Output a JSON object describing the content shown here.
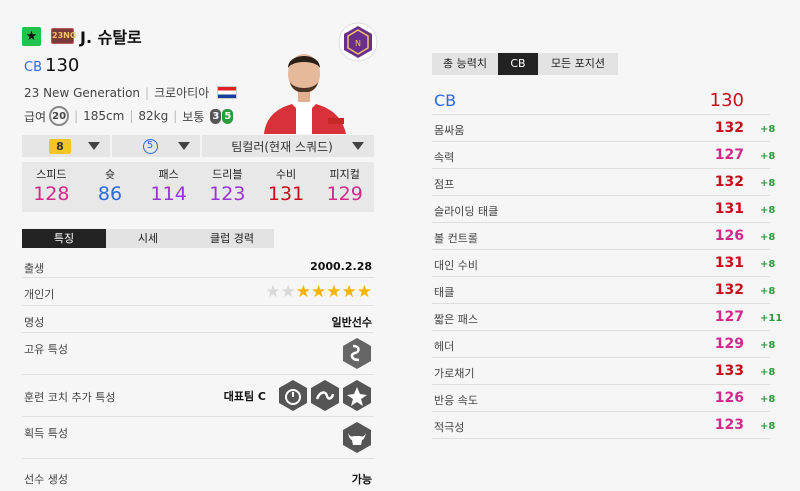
{
  "player": {
    "star_icon": "star-icon",
    "season_badge": "23NG",
    "name": "J. 슈탈로",
    "position": "CB",
    "overall": "130",
    "season_name": "23 New Generation",
    "nationality": "크로아티아",
    "salary_label": "급여",
    "salary": "20",
    "height": "185cm",
    "weight": "82kg",
    "body_type": "보통",
    "left_foot": "3",
    "right_foot": "5"
  },
  "controls": {
    "upgrade_level": "8",
    "enhance_level": "5",
    "team_color": "팀컬러(현재 스쿼드)"
  },
  "summary": [
    {
      "label": "스피드",
      "value": "128",
      "color": "#d02a8a"
    },
    {
      "label": "슛",
      "value": "86",
      "color": "#2b6ae0"
    },
    {
      "label": "패스",
      "value": "114",
      "color": "#9b34d6"
    },
    {
      "label": "드리블",
      "value": "123",
      "color": "#9b34d6"
    },
    {
      "label": "수비",
      "value": "131",
      "color": "#c4101c"
    },
    {
      "label": "피지컬",
      "value": "129",
      "color": "#d02a8a"
    }
  ],
  "tabs": [
    "특징",
    "시세",
    "클럽 경력"
  ],
  "details": {
    "birth_label": "출생",
    "birth": "2000.2.28",
    "popularity_label": "개인기",
    "popularity_stars": 5,
    "reputation_label": "명성",
    "reputation": "일반선수",
    "unique_trait_label": "고유 특성",
    "coach_trait_label": "훈련 코치 추가 특성",
    "national_team": "대표팀 C",
    "acquired_trait_label": "획득 특성",
    "creation_label": "선수 생성",
    "creation": "가능"
  },
  "right_tabs": [
    "총 능력치",
    "CB",
    "모든 포지션"
  ],
  "position_overall": {
    "label": "CB",
    "value": "130"
  },
  "stats": [
    {
      "name": "몸싸움",
      "value": "132",
      "delta": "+8",
      "color": "#c4101c"
    },
    {
      "name": "속력",
      "value": "127",
      "delta": "+8",
      "color": "#d02a8a"
    },
    {
      "name": "점프",
      "value": "132",
      "delta": "+8",
      "color": "#c4101c"
    },
    {
      "name": "슬라이딩 태클",
      "value": "131",
      "delta": "+8",
      "color": "#c4101c"
    },
    {
      "name": "볼 컨트롤",
      "value": "126",
      "delta": "+8",
      "color": "#d02a8a"
    },
    {
      "name": "대인 수비",
      "value": "131",
      "delta": "+8",
      "color": "#c4101c"
    },
    {
      "name": "태클",
      "value": "132",
      "delta": "+8",
      "color": "#c4101c"
    },
    {
      "name": "짧은 패스",
      "value": "127",
      "delta": "+11",
      "color": "#d02a8a"
    },
    {
      "name": "헤더",
      "value": "129",
      "delta": "+8",
      "color": "#d02a8a"
    },
    {
      "name": "가로채기",
      "value": "133",
      "delta": "+8",
      "color": "#c4101c"
    },
    {
      "name": "반응 속도",
      "value": "126",
      "delta": "+8",
      "color": "#d02a8a"
    },
    {
      "name": "적극성",
      "value": "123",
      "delta": "+8",
      "color": "#d02a8a"
    }
  ]
}
